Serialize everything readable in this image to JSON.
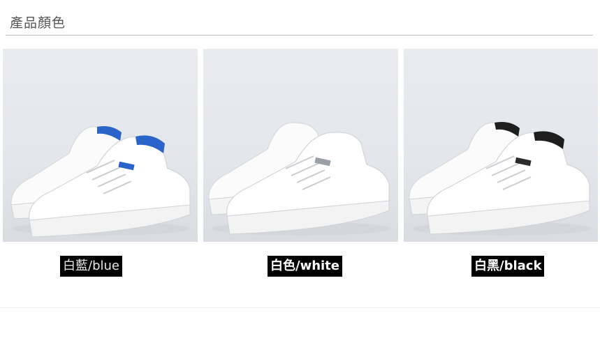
{
  "header": {
    "title": "產品顏色"
  },
  "colors": {
    "tile_bg": "#e6e8ec",
    "shoe_white": "#ffffff",
    "sole_shadow": "#cfd2d6",
    "accent_blue": "#2a63c9",
    "accent_black": "#1e1e1e"
  },
  "products": [
    {
      "label": "白藍/blue",
      "accent": "blue",
      "image": "white-sneaker-blue-heel"
    },
    {
      "label": "白色/white",
      "accent": "white",
      "image": "white-sneaker-white-heel"
    },
    {
      "label": "白黑/black",
      "accent": "black",
      "image": "white-sneaker-black-heel"
    }
  ]
}
